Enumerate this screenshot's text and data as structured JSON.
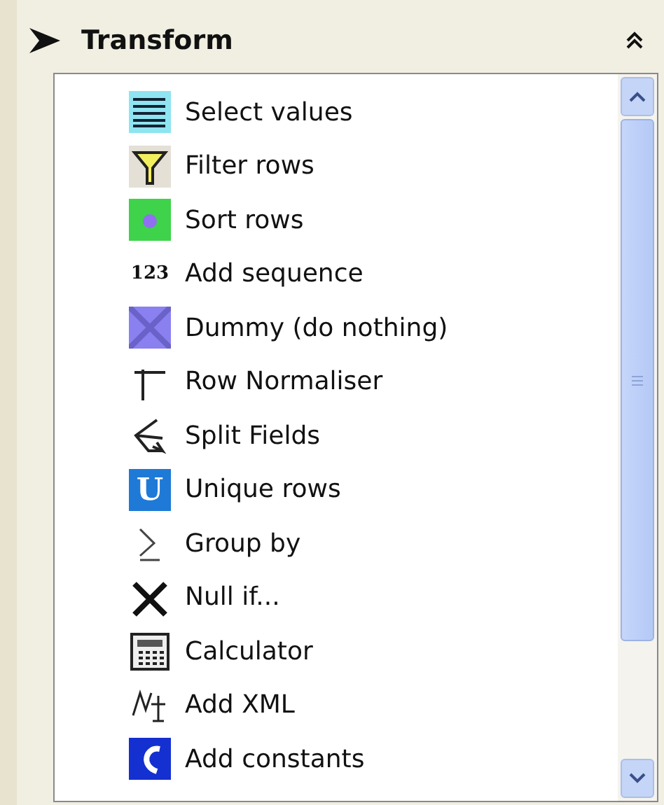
{
  "section": {
    "title": "Transform",
    "expanded": true
  },
  "steps": [
    {
      "label": "Select values",
      "kind": "select"
    },
    {
      "label": "Filter rows",
      "kind": "filter"
    },
    {
      "label": "Sort rows",
      "kind": "sort"
    },
    {
      "label": "Add sequence",
      "kind": "sequence",
      "icon_text": "123"
    },
    {
      "label": "Dummy (do nothing)",
      "kind": "dummy"
    },
    {
      "label": "Row Normaliser",
      "kind": "normaliser"
    },
    {
      "label": "Split Fields",
      "kind": "split"
    },
    {
      "label": "Unique rows",
      "kind": "unique",
      "icon_text": "U"
    },
    {
      "label": "Group by",
      "kind": "groupby"
    },
    {
      "label": "Null if...",
      "kind": "nullif"
    },
    {
      "label": "Calculator",
      "kind": "calculator"
    },
    {
      "label": "Add XML",
      "kind": "xml"
    },
    {
      "label": "Add constants",
      "kind": "constants"
    }
  ]
}
